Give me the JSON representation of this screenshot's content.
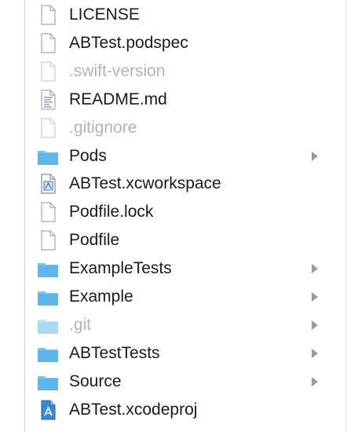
{
  "colors": {
    "folder": "#5fb6ea",
    "folder_dim": "#a9d7f3",
    "text": "#1a1a1a",
    "text_hidden": "#b3b3b3"
  },
  "files": [
    {
      "name": "LICENSE",
      "icon": "document-icon",
      "hidden": false,
      "folder": false
    },
    {
      "name": "ABTest.podspec",
      "icon": "document-icon",
      "hidden": false,
      "folder": false
    },
    {
      "name": ".swift-version",
      "icon": "document-icon",
      "hidden": true,
      "folder": false
    },
    {
      "name": "README.md",
      "icon": "text-document-icon",
      "hidden": false,
      "folder": false
    },
    {
      "name": ".gitignore",
      "icon": "document-icon",
      "hidden": true,
      "folder": false
    },
    {
      "name": "Pods",
      "icon": "folder-icon",
      "hidden": false,
      "folder": true
    },
    {
      "name": "ABTest.xcworkspace",
      "icon": "xcworkspace-icon",
      "hidden": false,
      "folder": false
    },
    {
      "name": "Podfile.lock",
      "icon": "document-icon",
      "hidden": false,
      "folder": false
    },
    {
      "name": "Podfile",
      "icon": "document-icon",
      "hidden": false,
      "folder": false
    },
    {
      "name": "ExampleTests",
      "icon": "folder-icon",
      "hidden": false,
      "folder": true
    },
    {
      "name": "Example",
      "icon": "folder-icon",
      "hidden": false,
      "folder": true
    },
    {
      "name": ".git",
      "icon": "folder-icon",
      "hidden": true,
      "folder": true
    },
    {
      "name": "ABTestTests",
      "icon": "folder-icon",
      "hidden": false,
      "folder": true
    },
    {
      "name": "Source",
      "icon": "folder-icon",
      "hidden": false,
      "folder": true
    },
    {
      "name": "ABTest.xcodeproj",
      "icon": "xcodeproj-icon",
      "hidden": false,
      "folder": false
    }
  ]
}
